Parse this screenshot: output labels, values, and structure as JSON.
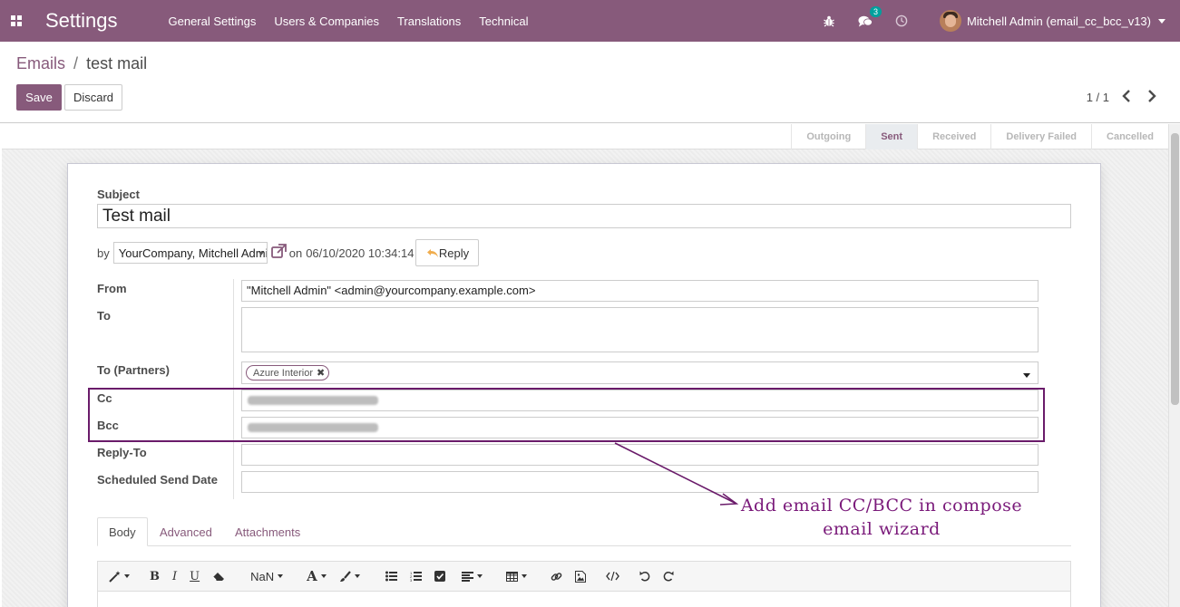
{
  "navbar": {
    "brand": "Settings",
    "menu": [
      "General Settings",
      "Users & Companies",
      "Translations",
      "Technical"
    ],
    "message_count": "3",
    "user_name": "Mitchell Admin (email_cc_bcc_v13)",
    "color": "#875a7b"
  },
  "breadcrumb": {
    "parent": "Emails",
    "separator": "/",
    "current": "test mail"
  },
  "buttons": {
    "save": "Save",
    "discard": "Discard"
  },
  "pager": {
    "value": "1 / 1"
  },
  "statusbar": [
    "Outgoing",
    "Sent",
    "Received",
    "Delivery Failed",
    "Cancelled"
  ],
  "statusbar_active": "Sent",
  "form": {
    "subject_label": "Subject",
    "subject_value": "Test mail",
    "by_label": "by",
    "author_value": "YourCompany, Mitchell Admin",
    "on_label": "on",
    "date_value": "06/10/2020 10:34:14",
    "reply_label": "Reply",
    "from_label": "From",
    "from_value": "\"Mitchell Admin\" <admin@yourcompany.example.com>",
    "to_label": "To",
    "to_value": "",
    "to_partners_label": "To (Partners)",
    "partner_tag": "Azure Interior",
    "cc_label": "Cc",
    "bcc_label": "Bcc",
    "reply_to_label": "Reply-To",
    "reply_to_value": "",
    "scheduled_label": "Scheduled Send Date",
    "scheduled_value": ""
  },
  "tabs": [
    "Body",
    "Advanced",
    "Attachments"
  ],
  "editor": {
    "font_size": "NaN"
  },
  "annotation": {
    "line1": "Add email CC/BCC in compose",
    "line2": "email wizard",
    "color": "#7a1a7a"
  }
}
